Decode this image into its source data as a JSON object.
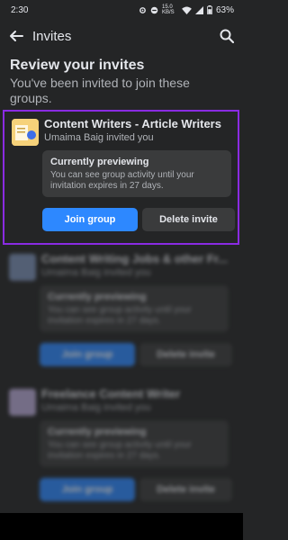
{
  "status_bar": {
    "time": "2:30",
    "speed": "15.0 KB/S",
    "battery": "63%"
  },
  "header": {
    "title": "Invites",
    "back_icon": "arrow-left-icon",
    "search_icon": "search-icon"
  },
  "section": {
    "title": "Review your invites",
    "subtitle": "You've been invited to join these groups."
  },
  "invites": [
    {
      "group_name": "Content Writers - Article Writers",
      "inviter": "Umaima Baig invited you",
      "preview_title": "Currently previewing",
      "preview_text": "You can see group activity until your invitation expires in 27 days.",
      "join_label": "Join group",
      "delete_label": "Delete invite"
    },
    {
      "group_name": "Content Writing Jobs & other Fr...",
      "inviter": "Umaima Baig invited you",
      "preview_title": "Currently previewing",
      "preview_text": "You can see group activity until your invitation expires in 27 days.",
      "join_label": "Join group",
      "delete_label": "Delete invite"
    },
    {
      "group_name": "Freelance Content Writer",
      "inviter": "Umaima Baig invited you",
      "preview_title": "Currently previewing",
      "preview_text": "You can see group activity until your invitation expires in 27 days.",
      "join_label": "Join group",
      "delete_label": "Delete invite"
    }
  ],
  "colors": {
    "background": "#242526",
    "accent": "#2d88ff",
    "highlight": "#8a2be2"
  }
}
